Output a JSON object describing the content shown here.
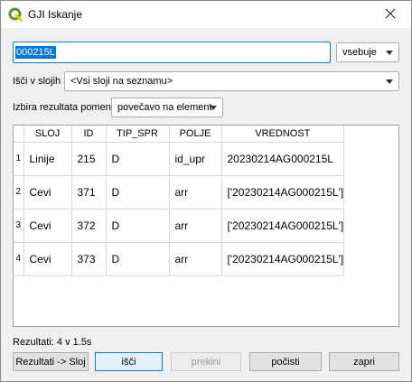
{
  "window": {
    "title": "GJI Iskanje",
    "app_icon": "qgis-logo-icon",
    "close_icon": "close-icon"
  },
  "search": {
    "value": "000215L",
    "match_mode": "vsebuje"
  },
  "layers": {
    "label": "Išči v slojih",
    "selected": "<Vsi sloji na seznamu>"
  },
  "zoom": {
    "label": "Izbira rezultata pomeni",
    "selected": "povečavo na element"
  },
  "table": {
    "columns": [
      "SLOJ",
      "ID",
      "TIP_SPR",
      "POLJE",
      "VREDNOST"
    ],
    "rows": [
      {
        "num": "1",
        "cells": [
          "Linije",
          "215",
          "D",
          "id_upr",
          "20230214AG000215L"
        ]
      },
      {
        "num": "2",
        "cells": [
          "Cevi",
          "371",
          "D",
          "arr",
          "['20230214AG000215L']"
        ]
      },
      {
        "num": "3",
        "cells": [
          "Cevi",
          "372",
          "D",
          "arr",
          "['20230214AG000215L']"
        ]
      },
      {
        "num": "4",
        "cells": [
          "Cevi",
          "373",
          "D",
          "arr",
          "['20230214AG000215L']"
        ]
      }
    ]
  },
  "status": "Rezultati: 4 v 1.5s",
  "buttons": {
    "to_layer": "Rezultati -> Sloj",
    "search": "išči",
    "abort": "prekini",
    "clear": "počisti",
    "close": "zapri"
  },
  "colors": {
    "accent": "#0078d7",
    "qgis_green": "#589632",
    "qgis_yellow": "#eec90d"
  }
}
